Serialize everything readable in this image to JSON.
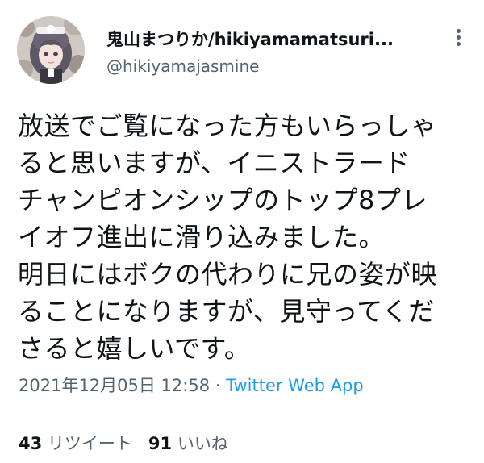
{
  "user": {
    "display_name": "鬼山まつりか/hikiyamamatsuri...",
    "handle": "@hikiyamajasmine",
    "avatar_icon": "profile-avatar"
  },
  "menu_icon": "more-options-icon",
  "tweet": {
    "lines": [
      "放送でご覧になった方もいらっしゃ",
      "ると思いますが、イニストラード",
      "チャンピオンシップのトップ8プレ",
      "イオフ進出に滑り込みました。",
      "明日にはボクの代わりに兄の姿が映",
      "ることになりますが、見守ってくだ",
      "さると嬉しいです。"
    ]
  },
  "meta": {
    "timestamp": "2021年12月05日 12:58",
    "separator": " · ",
    "source": "Twitter Web App"
  },
  "stats": {
    "retweets_count": "43",
    "retweets_label": "リツイート",
    "likes_count": "91",
    "likes_label": "いいね"
  },
  "colors": {
    "text": "#0f1419",
    "secondary": "#536471",
    "link": "#1d9bf0",
    "divider": "#e6e9ec"
  }
}
